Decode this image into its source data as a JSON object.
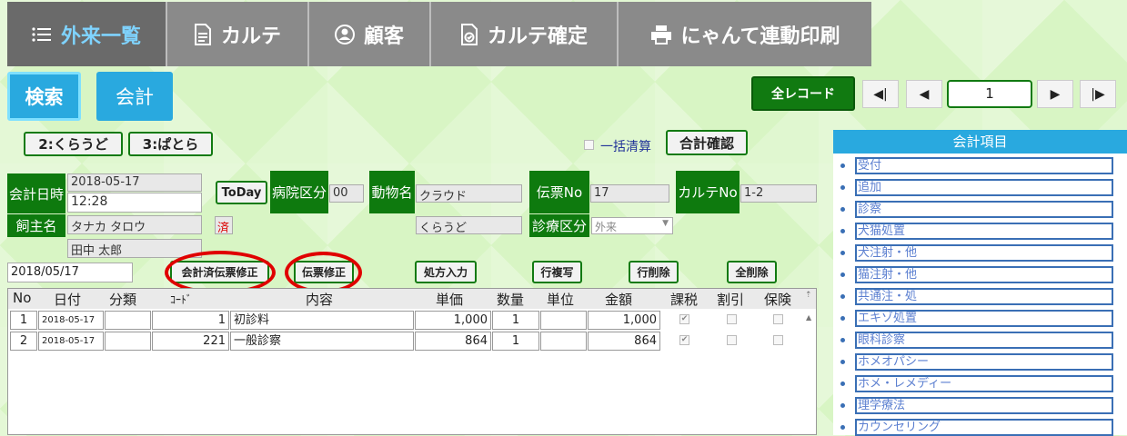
{
  "nav": {
    "tabs": [
      {
        "label": "外来一覧",
        "icon": "list-icon"
      },
      {
        "label": "カルテ",
        "icon": "document-icon"
      },
      {
        "label": "顧客",
        "icon": "user-icon"
      },
      {
        "label": "カルテ確定",
        "icon": "document-check-icon"
      },
      {
        "label": "にゃんて連動印刷",
        "icon": "printer-icon"
      }
    ]
  },
  "toolbar": {
    "search_label": "検索",
    "kaikei_label": "会計",
    "all_records_label": "全レコード",
    "first_label": "◀|",
    "prev_label": "◀",
    "page_value": "1",
    "next_label": "▶",
    "last_label": "|▶"
  },
  "filters": {
    "group1": "2:くらうど",
    "group2": "3:ぱとら",
    "bulk_settle_label": "一括清算",
    "total_confirm_label": "合計確認"
  },
  "form": {
    "date_label": "会計日時",
    "date_value": "2018-05-17",
    "time_value": "12:28",
    "today_label": "ToDay",
    "hospital_label": "病院区分",
    "hospital_value": "00",
    "animal_label": "動物名",
    "animal_value": "クラウド",
    "animal_kana": "くらうど",
    "slip_label": "伝票No",
    "slip_value": "17",
    "karte_label": "カルテNo",
    "karte_value": "1-2",
    "owner_label": "飼主名",
    "owner_kana": "タナカ タロウ",
    "owner_name": "田中 太郎",
    "settled_mark": "済",
    "care_label": "診療区分",
    "care_value": "外来"
  },
  "actions": {
    "entry_date": "2018/05/17",
    "settled_fix": "会計済伝票修正",
    "slip_fix": "伝票修正",
    "prescription": "処方入力",
    "row_copy": "行複写",
    "row_delete": "行削除",
    "delete_all": "全削除"
  },
  "table": {
    "headers": [
      "No",
      "日付",
      "分類",
      "ｺｰﾄﾞ",
      "内容",
      "単価",
      "数量",
      "単位",
      "金額",
      "課税",
      "割引",
      "保険"
    ],
    "rows": [
      {
        "no": "1",
        "date": "2018-05-17",
        "category": "",
        "code": "1",
        "content": "初診料",
        "price": "1,000",
        "qty": "1",
        "unit": "",
        "amount": "1,000",
        "tax": true,
        "discount": false,
        "insurance": false
      },
      {
        "no": "2",
        "date": "2018-05-17",
        "category": "",
        "code": "221",
        "content": "一般診察",
        "price": "864",
        "qty": "1",
        "unit": "",
        "amount": "864",
        "tax": true,
        "discount": false,
        "insurance": false
      }
    ]
  },
  "side": {
    "title": "会計項目",
    "items": [
      "受付",
      "追加",
      "診察",
      "犬猫処置",
      "犬注射・他",
      "猫注射・他",
      "共通注・処",
      "エキゾ処置",
      "眼科診察",
      "ホメオパシー",
      "ホメ・レメディー",
      "理学療法",
      "カウンセリング"
    ]
  }
}
